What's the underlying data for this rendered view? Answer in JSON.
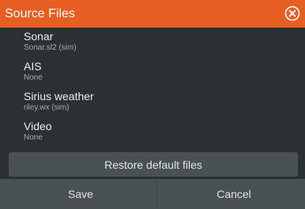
{
  "dialog": {
    "title": "Source Files",
    "close_icon": "close-circle-icon"
  },
  "items": [
    {
      "name": "Sonar",
      "file": "Sonar.sl2 (sim)"
    },
    {
      "name": "AIS",
      "file": "None"
    },
    {
      "name": "Sirius weather",
      "file": "riley.wx (sim)"
    },
    {
      "name": "Video",
      "file": "None"
    }
  ],
  "actions": {
    "restore_label": "Restore default files",
    "save_label": "Save",
    "cancel_label": "Cancel"
  },
  "colors": {
    "title_bar": "#e65e22",
    "dialog_bg": "#2b3033",
    "button_bg": "#4a5155"
  }
}
